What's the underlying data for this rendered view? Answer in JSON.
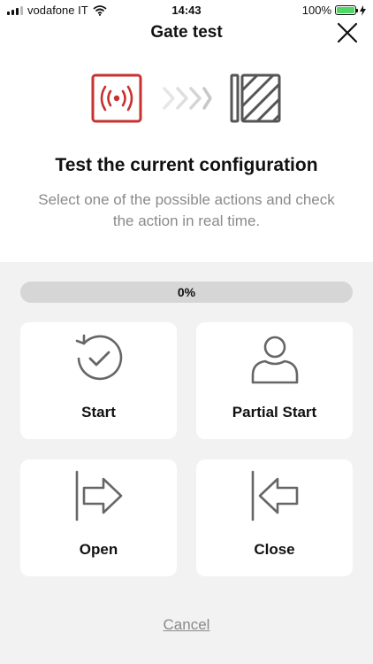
{
  "status_bar": {
    "carrier": "vodafone IT",
    "time": "14:43",
    "battery_percent": "100%",
    "battery_level": 1.0
  },
  "header": {
    "title": "Gate test",
    "close_icon": "close-icon"
  },
  "hero": {
    "icons": [
      "remote-signal-icon",
      "chevron-arrows-icon",
      "gate-icon"
    ],
    "colors": {
      "accent": "#c8312f",
      "muted": "#d4d4d4",
      "dark": "#555555"
    }
  },
  "intro": {
    "headline": "Test the current configuration",
    "subtitle": "Select one of the possible actions and check the action in real time."
  },
  "progress": {
    "label": "0%",
    "value": 0
  },
  "actions": {
    "start": {
      "label": "Start",
      "icon": "restart-check-icon"
    },
    "partial_start": {
      "label": "Partial Start",
      "icon": "person-icon"
    },
    "open": {
      "label": "Open",
      "icon": "open-arrow-icon"
    },
    "close": {
      "label": "Close",
      "icon": "close-arrow-icon"
    }
  },
  "footer": {
    "cancel_label": "Cancel"
  }
}
